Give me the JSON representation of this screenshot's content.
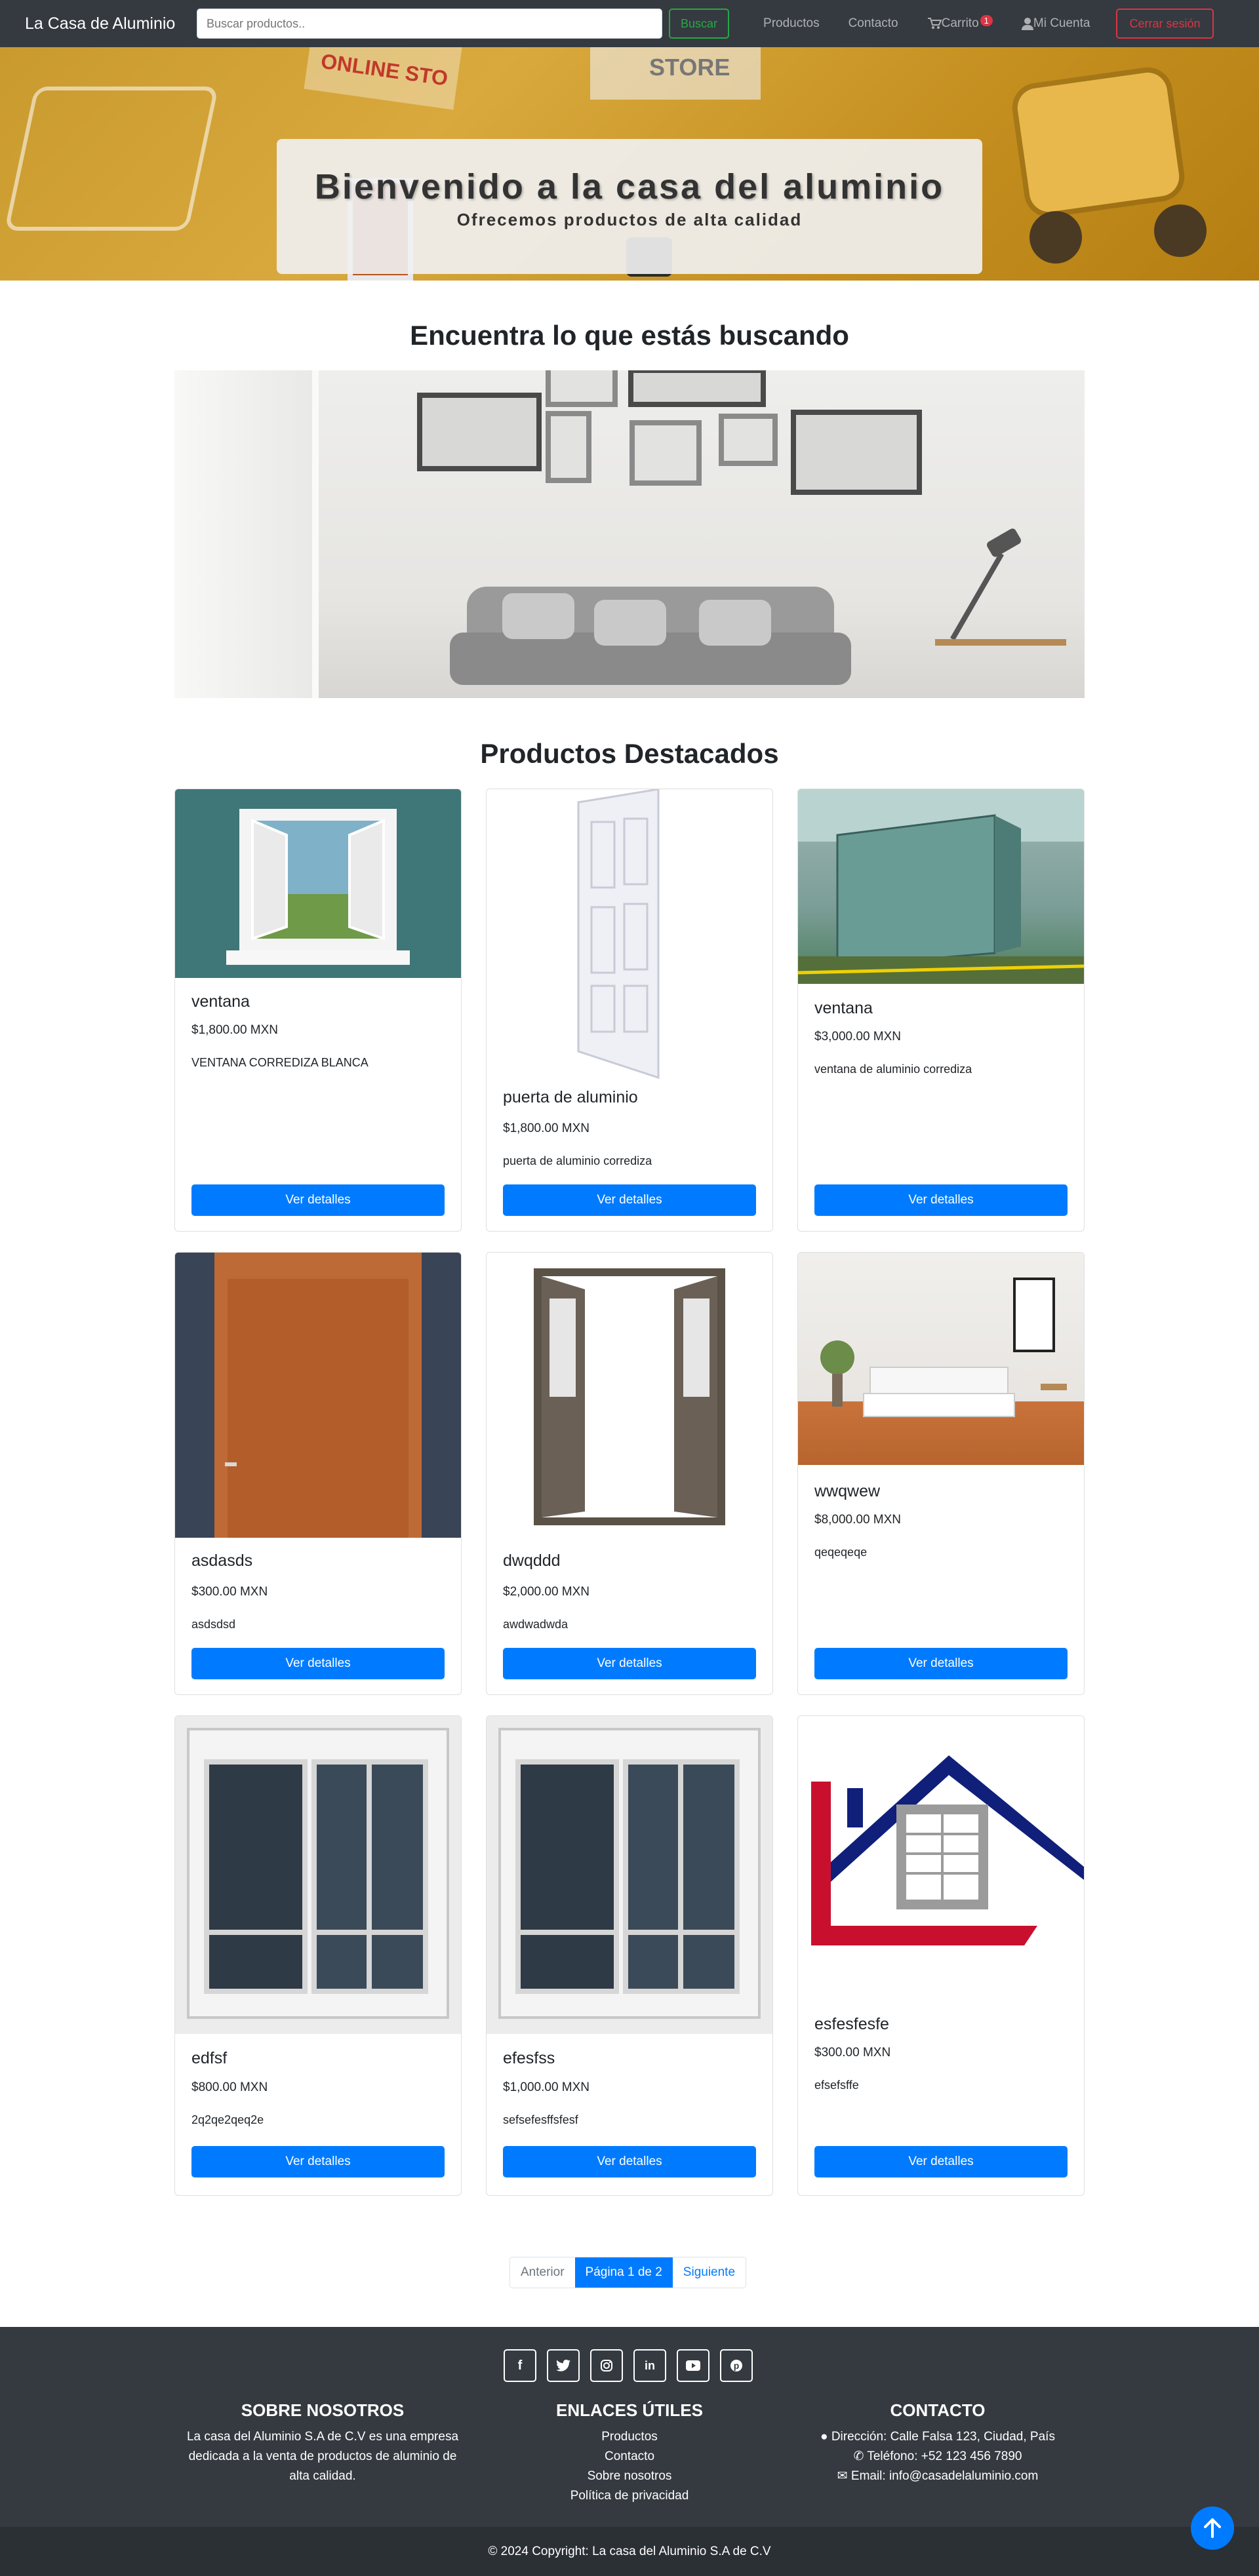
{
  "navbar": {
    "brand": "La Casa de Aluminio",
    "search_placeholder": "Buscar productos..",
    "search_button": "Buscar",
    "links": [
      "Productos",
      "Contacto"
    ],
    "cart_label": "Carrito",
    "cart_count": "1",
    "account_label": "Mi Cuenta",
    "logout_label": "Cerrar sesión"
  },
  "hero": {
    "title": "Bienvenido a la casa del aluminio",
    "subtitle": "Ofrecemos productos de alta calidad",
    "background_texts": [
      "ONLINE STO",
      "STORE"
    ]
  },
  "search_section": {
    "title": "Encuentra lo que estás buscando"
  },
  "featured": {
    "title": "Productos Destacados",
    "button_label": "Ver detalles",
    "products": [
      {
        "name": "ventana",
        "price": "$1,800.00 MXN",
        "description": "VENTANA CORREDIZA BLANCA"
      },
      {
        "name": "puerta de aluminio",
        "price": "$1,800.00 MXN",
        "description": "puerta de aluminio corrediza"
      },
      {
        "name": "ventana",
        "price": "$3,000.00 MXN",
        "description": "ventana de aluminio corrediza"
      },
      {
        "name": "asdasds",
        "price": "$300.00 MXN",
        "description": "asdsdsd"
      },
      {
        "name": "dwqddd",
        "price": "$2,000.00 MXN",
        "description": "awdwadwda"
      },
      {
        "name": "wwqwew",
        "price": "$8,000.00 MXN",
        "description": "qeqeqeqe"
      },
      {
        "name": "edfsf",
        "price": "$800.00 MXN",
        "description": "2q2qe2qeq2e"
      },
      {
        "name": "efesfss",
        "price": "$1,000.00 MXN",
        "description": "sefsefesffsfesf"
      },
      {
        "name": "esfesfesfe",
        "price": "$300.00 MXN",
        "description": "efsefsffe"
      }
    ]
  },
  "pagination": {
    "prev": "Anterior",
    "current": "Página 1 de 2",
    "next": "Siguiente"
  },
  "footer": {
    "socials": [
      "facebook-icon",
      "twitter-icon",
      "instagram-icon",
      "linkedin-icon",
      "youtube-icon",
      "pinterest-icon"
    ],
    "about_title": "SOBRE NOSOTROS",
    "about_text": "La casa del Aluminio S.A de C.V es una empresa dedicada a la venta de productos de aluminio de alta calidad.",
    "links_title": "ENLACES ÚTILES",
    "links": [
      "Productos",
      "Contacto",
      "Sobre nosotros",
      "Política de privacidad"
    ],
    "contact_title": "CONTACTO",
    "address": "Dirección: Calle Falsa 123, Ciudad, País",
    "phone": "Teléfono: +52 123 456 7890",
    "email": "Email: info@casadelaluminio.com",
    "copyright": "© 2024 Copyright: La casa del Aluminio S.A de C.V"
  },
  "colors": {
    "navbar": "#343a40",
    "primary": "#007bff",
    "success": "#28a745",
    "danger": "#dc3545"
  }
}
